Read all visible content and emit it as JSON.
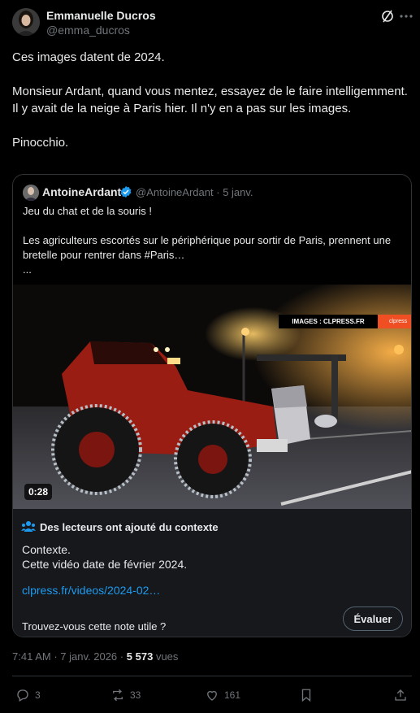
{
  "author": {
    "name": "Emmanuelle Ducros",
    "handle": "@emma_ducros"
  },
  "tweet": {
    "text": "Ces images datent de 2024.\n\nMonsieur Ardant, quand vous mentez, essayez de le faire intelligemment. Il y avait de la neige à Paris hier. Il n'y en a pas sur les images.\n\nPinocchio."
  },
  "quote": {
    "name": "AntoineArdant",
    "handle": "@AntoineArdant",
    "separator": "·",
    "date": "5 janv.",
    "text": "Jeu du chat et de la souris !\n\nLes agriculteurs escortés sur le périphérique pour sortir de Paris, prennent une bretelle pour rentrer dans #Paris…\n...",
    "video": {
      "duration": "0:28",
      "watermark": "IMAGES : CLPRESS.FR",
      "watermark_logo": "clpress"
    }
  },
  "community_note": {
    "title": "Des lecteurs ont ajouté du contexte",
    "body": "Contexte.\nCette vidéo date de février 2024.",
    "link": "clpress.fr/videos/2024-02…",
    "question": "Trouvez-vous cette note utile ?",
    "rate_button": "Évaluer"
  },
  "meta": {
    "time": "7:41 AM",
    "separator1": "·",
    "date": "7 janv. 2026",
    "separator2": "·",
    "views_count": "5 573",
    "views_label": "vues"
  },
  "actions": {
    "replies": "3",
    "reposts": "33",
    "likes": "161"
  },
  "colors": {
    "background": "#000000",
    "text": "#e7e9ea",
    "secondary": "#71767b",
    "link": "#1d9bf0",
    "verified": "#1d9bf0",
    "note_bg": "#16181c",
    "border": "#2f3336"
  },
  "icons": [
    "grok-icon",
    "more-icon",
    "verified-badge-icon",
    "community-notes-icon",
    "reply-icon",
    "repost-icon",
    "like-icon",
    "bookmark-icon",
    "share-icon"
  ]
}
